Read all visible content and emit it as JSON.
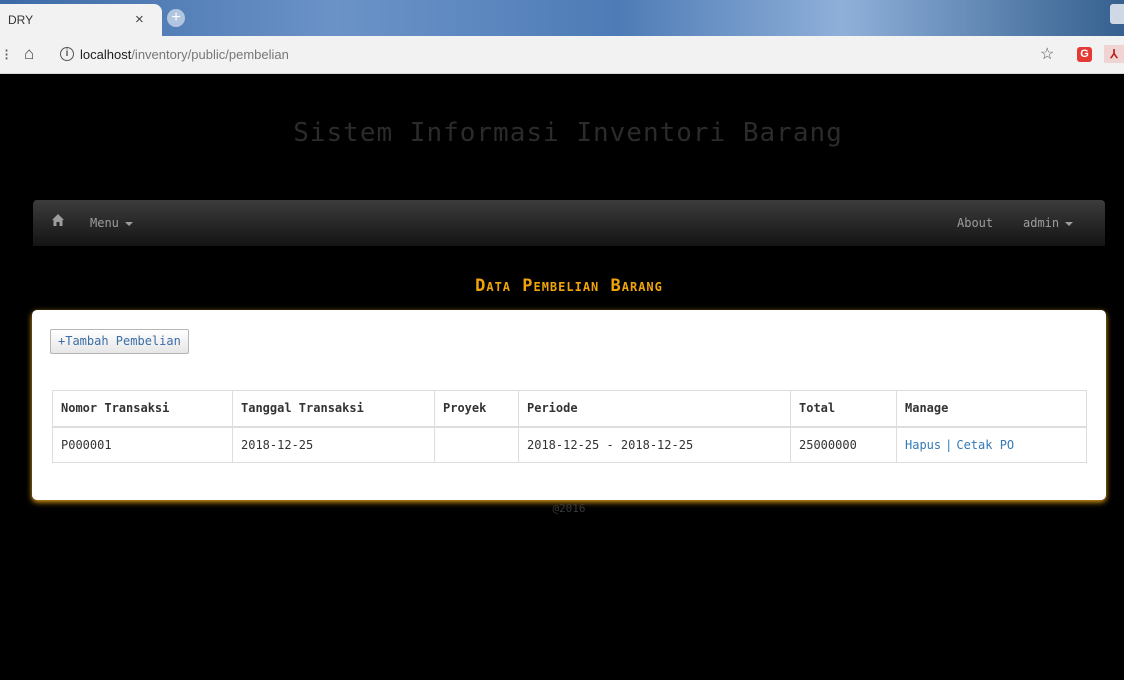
{
  "browser": {
    "tab_title": "DRY",
    "tab_close": "×",
    "new_tab": "+",
    "url_host": "localhost",
    "url_path": "/inventory/public/pembelian"
  },
  "site": {
    "title": "Sistem Informasi Inventori Barang",
    "footer": "@2016"
  },
  "navbar": {
    "menu_label": "Menu",
    "about_label": "About",
    "user_label": "admin"
  },
  "page": {
    "heading": "Data Pembelian Barang",
    "add_button": "+Tambah Pembelian"
  },
  "table": {
    "headers": [
      "Nomor Transaksi",
      "Tanggal Transaksi",
      "Proyek",
      "Periode",
      "Total",
      "Manage"
    ],
    "rows": [
      {
        "nomor": "P000001",
        "tanggal": "2018-12-25",
        "proyek": "",
        "periode": "2018-12-25 - 2018-12-25",
        "total": "25000000",
        "action_delete": "Hapus",
        "action_separator": "|",
        "action_print": "Cetak PO"
      }
    ]
  },
  "colors": {
    "heading_accent": "#f0a30a",
    "link": "#337ab7",
    "panel_glow": "#e6a21a"
  }
}
